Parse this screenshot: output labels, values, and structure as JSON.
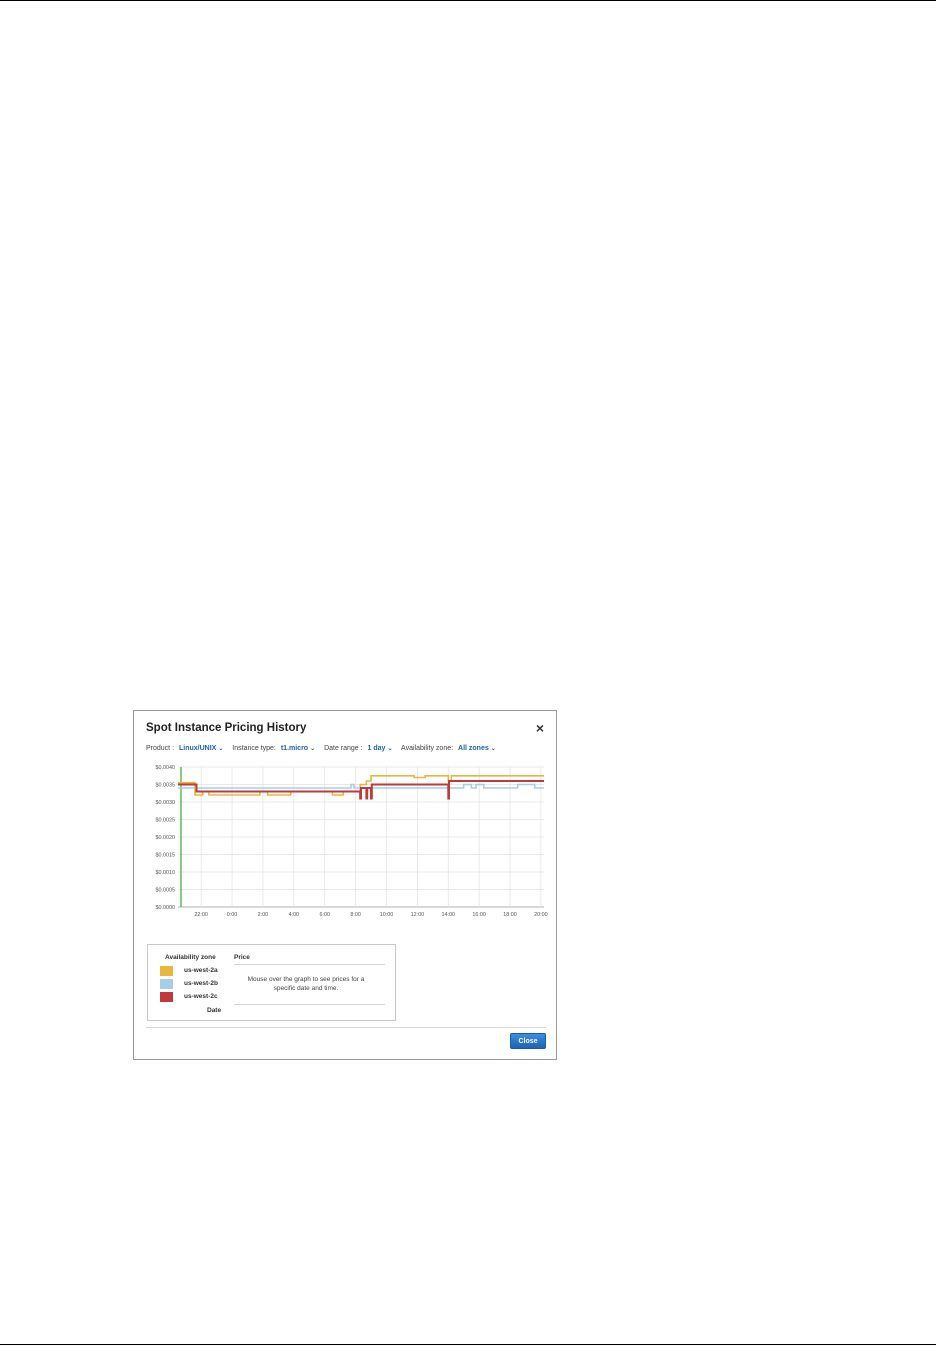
{
  "dialog": {
    "title": "Spot Instance Pricing History",
    "close_icon": "close-icon",
    "close_glyph": "×"
  },
  "filters": {
    "product_label": "Product :",
    "product_value": "Linux/UNIX",
    "instance_label": "Instance type:",
    "instance_value": "t1.micro",
    "date_label": "Date range :",
    "date_value": "1 day",
    "zone_label": "Availability zone:",
    "zone_value": "All zones",
    "chevron_icon": "chevron-down-icon"
  },
  "legend": {
    "col_zone": "Availability zone",
    "col_price": "Price",
    "message": "Mouse over the graph to see prices for a specific date and time.",
    "date_label": "Date",
    "items": [
      {
        "name": "us-west-2a",
        "color": "#e8b83a"
      },
      {
        "name": "us-west-2b",
        "color": "#a8cde8"
      },
      {
        "name": "us-west-2c",
        "color": "#c0393b"
      }
    ]
  },
  "footer": {
    "close_label": "Close"
  },
  "chart_data": {
    "type": "line",
    "title": "",
    "xlabel": "",
    "ylabel": "",
    "x_ticks": [
      "22:00",
      "0:00",
      "2:00",
      "4:00",
      "6:00",
      "8:00",
      "10:00",
      "12:00",
      "14:00",
      "16:00",
      "18:00",
      "20:00"
    ],
    "y_ticks": [
      "$0.0000",
      "$0.0005",
      "$0.0010",
      "$0.0015",
      "$0.0020",
      "$0.0025",
      "$0.0030",
      "$0.0035",
      "$0.0040"
    ],
    "ylim": [
      0,
      0.004
    ],
    "xlim_hours": [
      -3.5,
      20.2
    ],
    "grid": true,
    "current_time_marker_color": "#3aa83a",
    "series": [
      {
        "name": "us-west-2a",
        "color": "#e8b83a",
        "points": [
          [
            -3.5,
            0.00355
          ],
          [
            -2.4,
            0.00355
          ],
          [
            -2.4,
            0.0032
          ],
          [
            -1.9,
            0.0032
          ],
          [
            -1.9,
            0.0033
          ],
          [
            -1.5,
            0.0033
          ],
          [
            -1.5,
            0.0032
          ],
          [
            1.8,
            0.0032
          ],
          [
            1.8,
            0.0033
          ],
          [
            2.3,
            0.0033
          ],
          [
            2.3,
            0.0032
          ],
          [
            3.8,
            0.0032
          ],
          [
            3.8,
            0.0033
          ],
          [
            6.5,
            0.0033
          ],
          [
            6.5,
            0.0032
          ],
          [
            7.2,
            0.0032
          ],
          [
            7.2,
            0.0033
          ],
          [
            8.3,
            0.0033
          ],
          [
            8.3,
            0.0035
          ],
          [
            8.7,
            0.0035
          ],
          [
            8.7,
            0.0036
          ],
          [
            9.0,
            0.0036
          ],
          [
            9.0,
            0.00375
          ],
          [
            11.8,
            0.00375
          ],
          [
            11.8,
            0.0037
          ],
          [
            12.5,
            0.0037
          ],
          [
            12.5,
            0.00375
          ],
          [
            14.0,
            0.00375
          ],
          [
            14.0,
            0.0036
          ],
          [
            14.2,
            0.0036
          ],
          [
            14.2,
            0.00375
          ],
          [
            20.2,
            0.00375
          ]
        ]
      },
      {
        "name": "us-west-2b",
        "color": "#a8cde8",
        "points": [
          [
            -3.5,
            0.0034
          ],
          [
            7.7,
            0.0034
          ],
          [
            7.7,
            0.0035
          ],
          [
            7.9,
            0.0035
          ],
          [
            7.9,
            0.0034
          ],
          [
            15.0,
            0.0034
          ],
          [
            15.0,
            0.0035
          ],
          [
            15.5,
            0.0035
          ],
          [
            15.5,
            0.0034
          ],
          [
            15.8,
            0.0034
          ],
          [
            15.8,
            0.0035
          ],
          [
            16.3,
            0.0035
          ],
          [
            16.3,
            0.0034
          ],
          [
            18.5,
            0.0034
          ],
          [
            18.5,
            0.0035
          ],
          [
            19.6,
            0.0035
          ],
          [
            19.6,
            0.0034
          ],
          [
            20.2,
            0.0034
          ]
        ]
      },
      {
        "name": "us-west-2c",
        "color": "#c0393b",
        "points": [
          [
            -3.5,
            0.0035
          ],
          [
            -2.3,
            0.0035
          ],
          [
            -2.3,
            0.0033
          ],
          [
            8.3,
            0.0033
          ],
          [
            8.3,
            0.0031
          ],
          [
            8.35,
            0.0031
          ],
          [
            8.35,
            0.0034
          ],
          [
            8.7,
            0.0034
          ],
          [
            8.7,
            0.0031
          ],
          [
            8.75,
            0.0031
          ],
          [
            8.75,
            0.0034
          ],
          [
            9.0,
            0.0034
          ],
          [
            9.0,
            0.0031
          ],
          [
            9.05,
            0.0031
          ],
          [
            9.05,
            0.0035
          ],
          [
            14.0,
            0.0035
          ],
          [
            14.0,
            0.0031
          ],
          [
            14.05,
            0.0031
          ],
          [
            14.05,
            0.0036
          ],
          [
            20.2,
            0.0036
          ]
        ]
      }
    ]
  }
}
